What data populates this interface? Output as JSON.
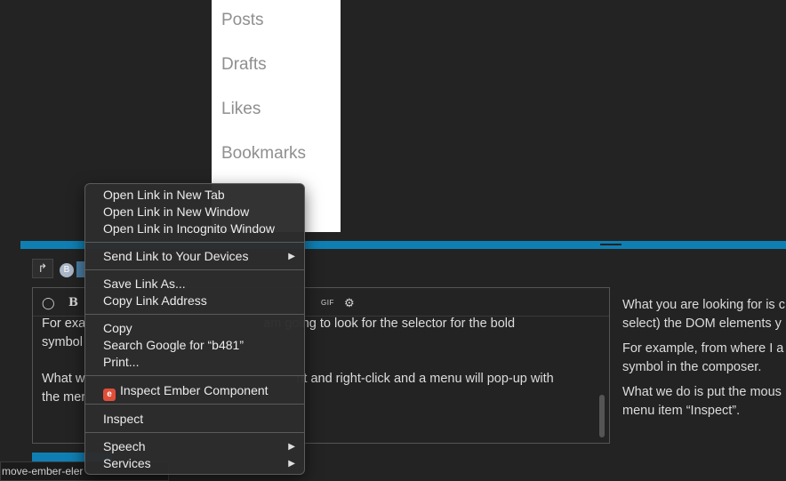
{
  "user_menu": {
    "items": [
      "Posts",
      "Drafts",
      "Likes",
      "Bookmarks"
    ]
  },
  "composer": {
    "avatar_letter": "B",
    "toolbar": {
      "bold": "B",
      "gif": "GIF"
    },
    "editor_lines": [
      "For exa",
      "symbol",
      "What w",
      "the mer"
    ],
    "editor_lines_right": [
      "am going to look for the selector for the bold",
      "",
      "nt and right-click and a menu will pop-up with",
      ""
    ],
    "preview": [
      "What you are looking for is c",
      "select) the DOM elements y",
      "For example, from where I a",
      "symbol in the composer.",
      "What we do is put the mous",
      "menu item “Inspect”."
    ]
  },
  "status_bar": {
    "text": "move-ember-eler"
  },
  "context_menu": {
    "items": [
      {
        "label": "Open Link in New Tab"
      },
      {
        "label": "Open Link in New Window"
      },
      {
        "label": "Open Link in Incognito Window"
      },
      {
        "label": "Send Link to Your Devices",
        "submenu": true
      },
      {
        "label": "Save Link As..."
      },
      {
        "label": "Copy Link Address"
      },
      {
        "label": "Copy"
      },
      {
        "label": "Search Google for “b481”"
      },
      {
        "label": "Print..."
      },
      {
        "label": "Inspect Ember Component",
        "icon": "ember-icon"
      },
      {
        "label": "Inspect"
      },
      {
        "label": "Speech",
        "submenu": true
      },
      {
        "label": "Services",
        "submenu": true
      }
    ],
    "ember_icon_letter": "e",
    "submenu_arrow": "▶"
  },
  "colors": {
    "accent": "#0f7fb3",
    "background": "#232323",
    "menu_bg": "#2c2c2c",
    "ember": "#e04e39"
  }
}
